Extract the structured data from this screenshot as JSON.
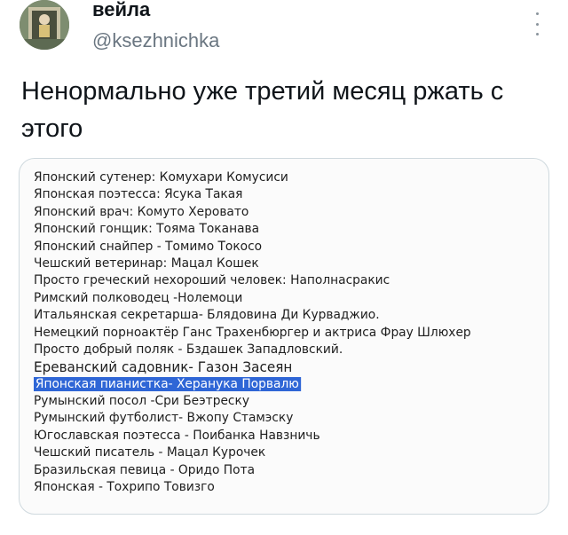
{
  "author": {
    "name": "вейла",
    "handle": "@ksezhnichka"
  },
  "tweet": {
    "text": "Ненормально уже третий месяц ржать с этого"
  },
  "list": [
    "Японский сутенер: Комухари Комусиси",
    "Японская поэтесса: Ясука Такая",
    "Японский врач: Комуто Херовато",
    "Японский гонщик: Тояма Токанава",
    "Японский снайпер - Томимо Токосо",
    "Чешский ветеринар: Мацал Кошек",
    "Просто греческий нехороший человек: Наполнасракис",
    "Римский полководец -Нолемоци",
    "Итальянская секретарша- Блядовина Ди Курваджио.",
    "Немецкий порноактёр Ганс Трахенбюргер и актриса Фрау Шлюхер",
    "Просто добрый поляк - Бздашек Западловский.",
    "Ереванский садовник- Газон Засеян",
    "Японская пианистка- Херанука Порвалю",
    "Румынский посол -Сри Беэтреску",
    "Румынский футболист- Вжопу Стамэску",
    "Югославская поэтесса - Поибанка Навзничь",
    "Чешский писатель - Мацал Курочек",
    "Бразильская певица - Оридо Пота",
    "Японская - Тохрипо Товизго"
  ],
  "highlighted_index": 12,
  "icons": {
    "menu": "more-vertical-icon",
    "avatar": "profile-avatar"
  },
  "colors": {
    "highlight": "#2f66d6",
    "handle": "#6a7681",
    "border": "#cfd9de"
  }
}
